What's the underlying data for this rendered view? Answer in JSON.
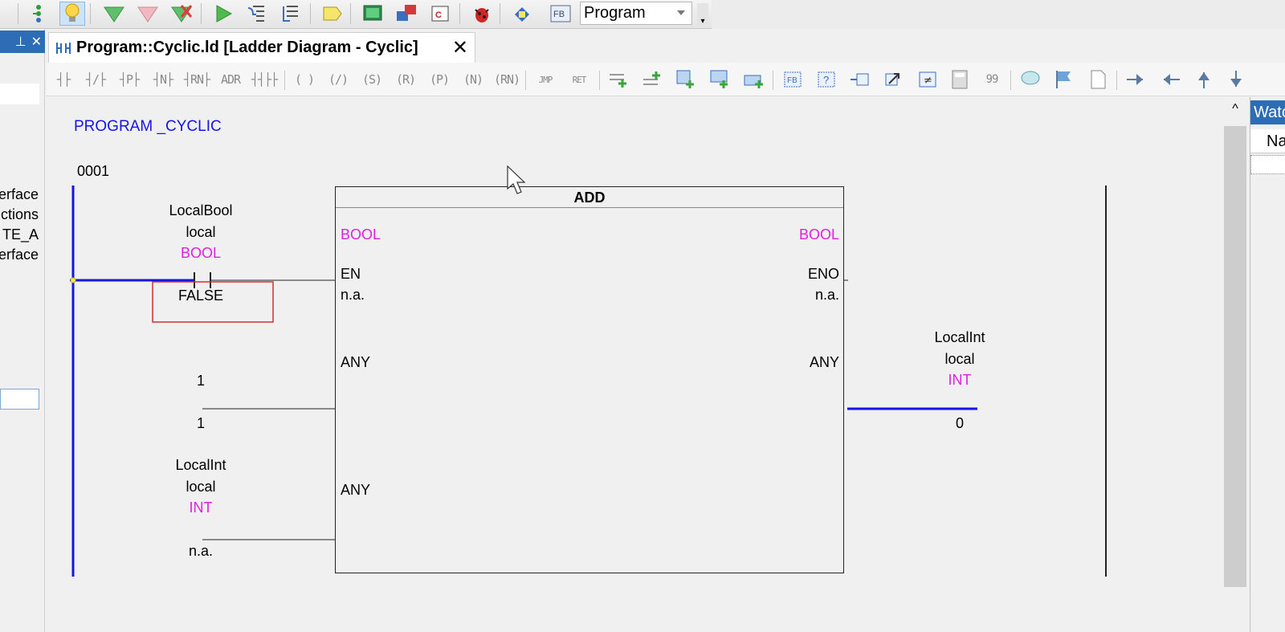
{
  "toolbar": {
    "program_selector_value": "Program",
    "icons": [
      "step-icon",
      "bulb-icon",
      "download-icon",
      "rollback-icon",
      "cancel-download-icon",
      "run-icon",
      "step-into-icon",
      "step-out-icon",
      "tag-icon",
      "monitor-icon",
      "transfer-icon",
      "compile-icon",
      "debug-bug-icon",
      "deploy-icon",
      "function-block-icon"
    ]
  },
  "left_panel": {
    "lines": [
      "erface",
      "ctions",
      "TE_A",
      "erface"
    ]
  },
  "editor_tab": {
    "title": "Program::Cyclic.ld [Ladder Diagram - Cyclic]",
    "close_glyph": "✕"
  },
  "ladder_toolbar": {
    "glyphs": [
      "┤├",
      "┤/├",
      "┤P├",
      "┤N├",
      "┤RN├",
      "ADR",
      "┤┤├├",
      "( )",
      "(/)",
      "(S)",
      "(R)",
      "(P)",
      "(N)",
      "(RN)",
      "JMP",
      "RET"
    ]
  },
  "diagram": {
    "program_name": "PROGRAM _CYCLIC",
    "rung_number": "0001",
    "contact": {
      "var_name": "LocalBool",
      "scope": "local",
      "type": "BOOL",
      "value": "FALSE"
    },
    "function_block": {
      "name": "ADD",
      "in_en_type": "BOOL",
      "in_en_name": "EN",
      "in_en_value": "n.a.",
      "out_eno_type": "BOOL",
      "out_eno_name": "ENO",
      "out_eno_value": "n.a.",
      "in1_type": "ANY",
      "in2_type": "ANY",
      "out_type": "ANY"
    },
    "input1": {
      "label": "1",
      "value": "1"
    },
    "input2": {
      "var_name": "LocalInt",
      "scope": "local",
      "type": "INT",
      "value": "n.a."
    },
    "output": {
      "var_name": "LocalInt",
      "scope": "local",
      "type": "INT",
      "value": "0"
    }
  },
  "watch_panel": {
    "title": "Watch",
    "column_name": "Name"
  },
  "scrollbar": {
    "up_glyph": "^"
  },
  "colors": {
    "program_title": "#1414e8",
    "type_label": "#e020e0",
    "power_rail": "#1414e8",
    "highlight_box": "#d32f2f"
  }
}
